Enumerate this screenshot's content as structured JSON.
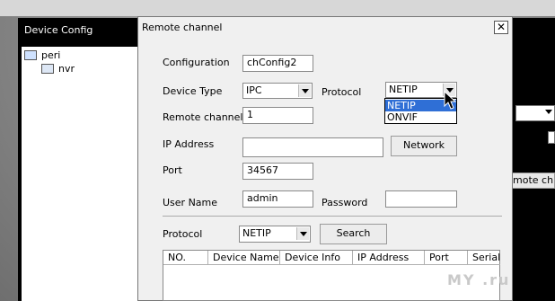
{
  "parent_window": {
    "title": "Device Config",
    "tree": [
      {
        "label": "peri"
      },
      {
        "label": "nvr"
      }
    ],
    "right_text": "mote ch..."
  },
  "dialog": {
    "title": "Remote channel",
    "close_glyph": "✕",
    "configuration": {
      "label": "Configuration",
      "value": "chConfig2"
    },
    "device_type": {
      "label": "Device Type",
      "value": "IPC"
    },
    "protocol": {
      "label": "Protocol",
      "value": "NETIP",
      "options": [
        "NETIP",
        "ONVIF"
      ],
      "selected": "NETIP"
    },
    "remote_channel": {
      "label": "Remote channel",
      "value": "1"
    },
    "ip_address": {
      "label": "IP Address",
      "value": ""
    },
    "network_button": "Network",
    "port": {
      "label": "Port",
      "value": "34567"
    },
    "user_name": {
      "label": "User Name",
      "value": "admin"
    },
    "password": {
      "label": "Password",
      "value": ""
    },
    "search_protocol": {
      "label": "Protocol",
      "value": "NETIP"
    },
    "search_button": "Search",
    "table_headers": [
      "NO.",
      "Device Name",
      "Device Info",
      "IP Address",
      "Port",
      "Serial ID"
    ]
  },
  "watermark": "MY .ru"
}
